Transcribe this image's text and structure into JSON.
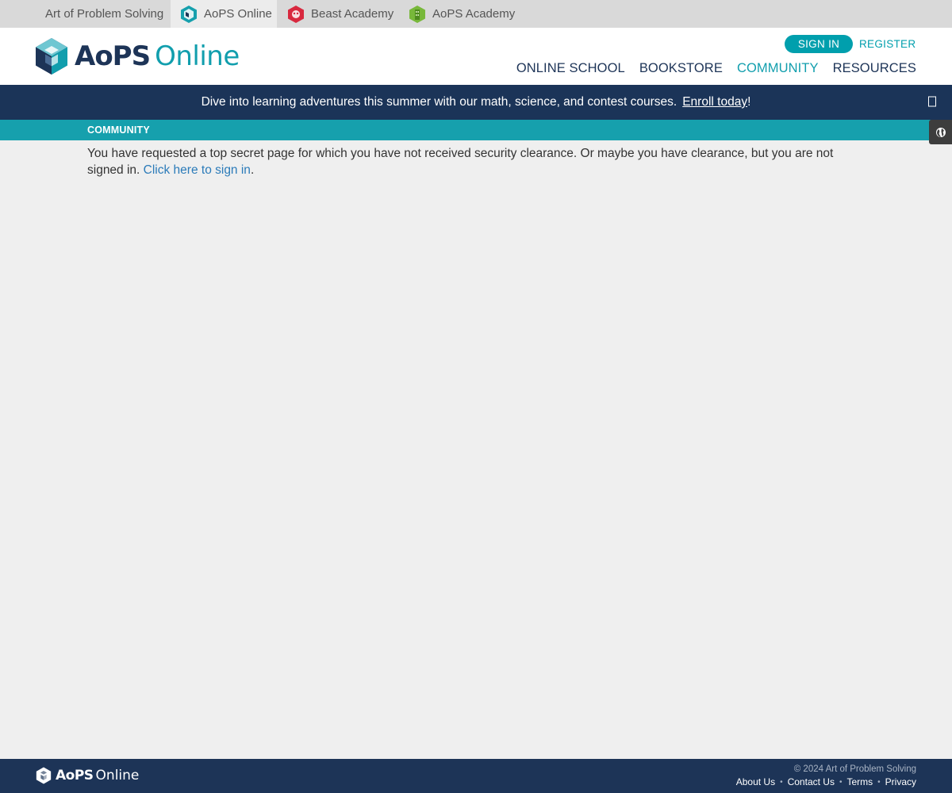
{
  "site_tabs": [
    {
      "label": "Art of Problem Solving",
      "icon": "none"
    },
    {
      "label": "AoPS Online",
      "icon": "aops-online-icon"
    },
    {
      "label": "Beast Academy",
      "icon": "beast-academy-icon"
    },
    {
      "label": "AoPS Academy",
      "icon": "aops-academy-icon"
    }
  ],
  "header": {
    "logo_aops": "AoPS",
    "logo_online": "Online",
    "sign_in": "SIGN IN",
    "register": "REGISTER",
    "nav": [
      "ONLINE SCHOOL",
      "BOOKSTORE",
      "COMMUNITY",
      "RESOURCES"
    ],
    "active_nav": "COMMUNITY"
  },
  "banner": {
    "text": "Dive into learning adventures this summer with our math, science, and contest courses.",
    "link": "Enroll today",
    "suffix": "!"
  },
  "section": {
    "title": "COMMUNITY"
  },
  "content": {
    "message": "You have requested a top secret page for which you have not received security clearance. Or maybe you have clearance, but you are not signed in.",
    "link": "Click here to sign in",
    "suffix": "."
  },
  "footer": {
    "logo_aops": "AoPS",
    "logo_online": "Online",
    "copyright": "© 2024 Art of Problem Solving",
    "links": [
      "About Us",
      "Contact Us",
      "Terms",
      "Privacy"
    ]
  },
  "colors": {
    "navy": "#1d3457",
    "teal": "#119ead",
    "banner": "#1b3458",
    "section_bar": "#16a0ad",
    "link": "#2b7bb9"
  }
}
